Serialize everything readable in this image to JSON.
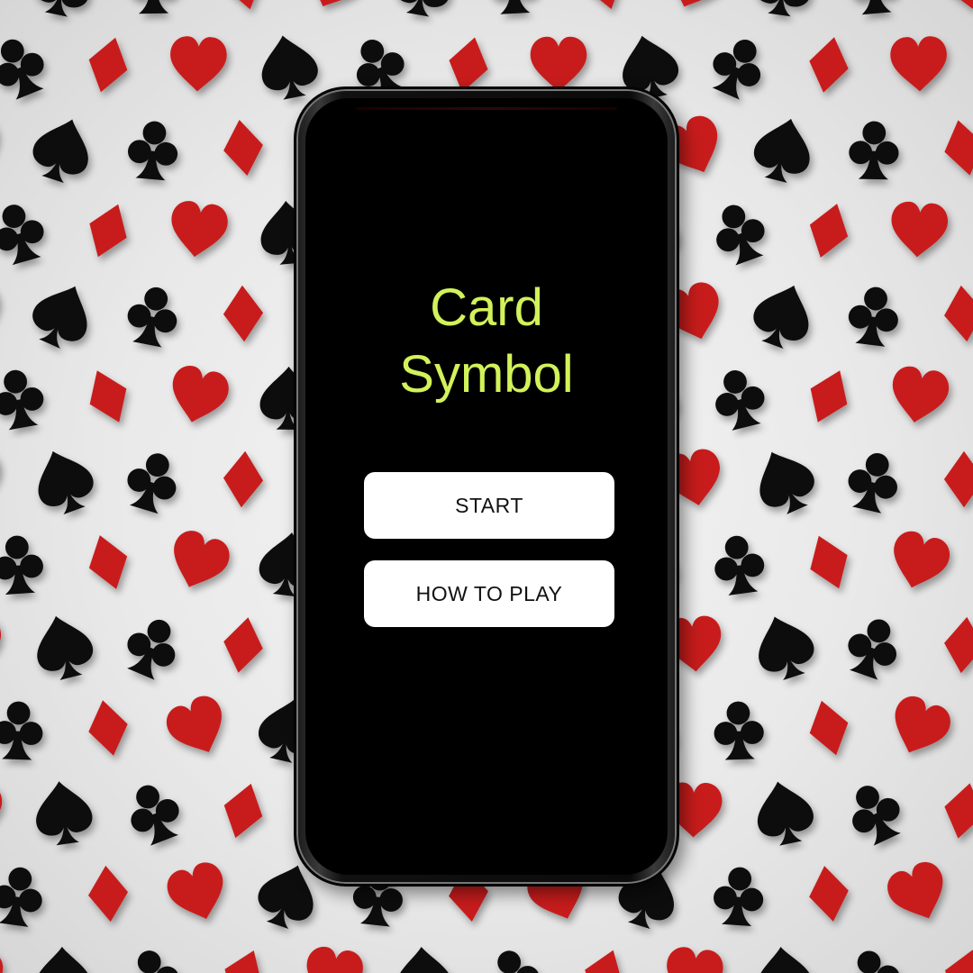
{
  "background": {
    "pattern_icons": [
      "heart-icon",
      "spade-icon",
      "club-icon",
      "diamond-icon"
    ],
    "colors": {
      "red": "#c81c1c",
      "black": "#0a0a0a",
      "base": "#ececec"
    }
  },
  "app": {
    "title_line1": "Card",
    "title_line2": "Symbol",
    "title_color": "#d2f25a"
  },
  "menu": {
    "start_label": "START",
    "how_to_play_label": "HOW TO PLAY"
  }
}
